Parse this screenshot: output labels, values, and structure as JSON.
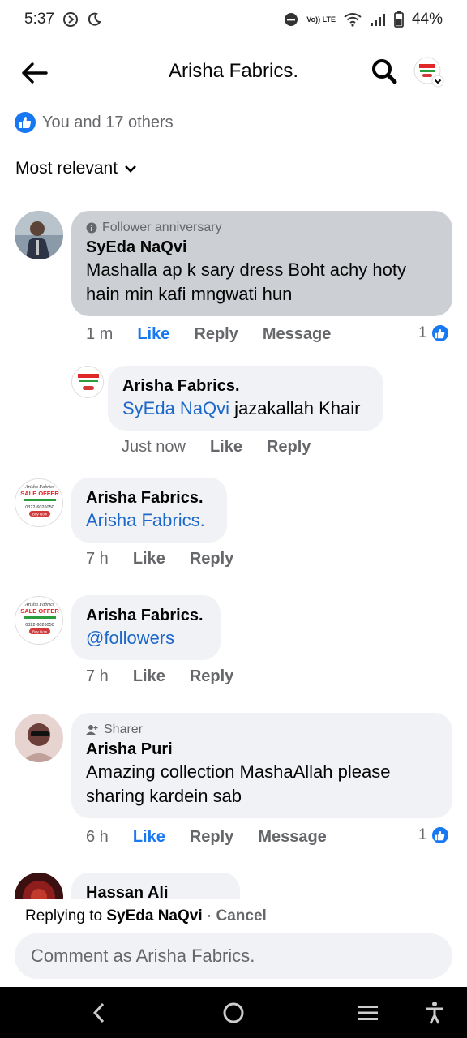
{
  "status_bar": {
    "time": "5:37",
    "battery": "44%",
    "network_label": "Vo)) LTE"
  },
  "header": {
    "title": "Arisha Fabrics."
  },
  "reactions": {
    "summary": "You and 17 others"
  },
  "sort": {
    "label": "Most relevant"
  },
  "comments": [
    {
      "badge": "Follower anniversary",
      "author": "SyEda NaQvi",
      "text": "Mashalla ap k sary dress Boht achy hoty hain min kafi mngwati hun",
      "time": "1 m",
      "like": "Like",
      "reply": "Reply",
      "message": "Message",
      "reaction_count": "1"
    },
    {
      "author": "Arisha Fabrics.",
      "mention": "SyEda NaQvi",
      "text": " jazakallah Khair",
      "time": "Just now",
      "like": "Like",
      "reply": "Reply"
    },
    {
      "author": "Arisha Fabrics.",
      "mention": "Arisha Fabrics.",
      "time": "7 h",
      "like": "Like",
      "reply": "Reply"
    },
    {
      "author": "Arisha Fabrics.",
      "mention": "@followers",
      "time": "7 h",
      "like": "Like",
      "reply": "Reply"
    },
    {
      "badge": "Sharer",
      "author": "Arisha Puri",
      "text": "Amazing collection MashaAllah please sharing kardein sab",
      "time": "6 h",
      "like": "Like",
      "reply": "Reply",
      "message": "Message",
      "reaction_count": "1"
    },
    {
      "author": "Hassan Ali"
    }
  ],
  "reply_bar": {
    "prefix": "Replying to ",
    "target": "SyEda NaQvi",
    "separator": " · ",
    "cancel": "Cancel",
    "placeholder": "Comment as Arisha Fabrics."
  },
  "page_avatar_logo": {
    "line1": "Arisha Fabrics",
    "line2": "SALE OFFER",
    "line3": "0322-6026050",
    "line4": "Buy Now"
  },
  "colors": {
    "accent": "#1877f2",
    "bubble_highlight": "#ccd0d5",
    "bubble": "#f0f2f5",
    "muted": "#65676b"
  }
}
